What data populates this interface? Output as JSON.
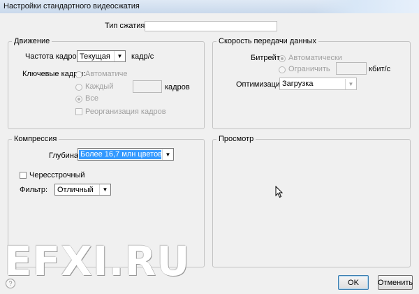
{
  "window": {
    "title": "Настройки стандартного видеосжатия"
  },
  "compression_type": {
    "label": "Тип сжатия:",
    "value": ""
  },
  "motion": {
    "legend": "Движение",
    "frame_rate": {
      "label": "Частота кадров:",
      "value": "Текущая",
      "unit": "кадр/с"
    },
    "key_frames": {
      "label": "Ключевые кадры:",
      "auto": "Автоматически",
      "every": "Каждый",
      "every_value": "",
      "every_unit": "кадров",
      "all": "Все",
      "reorder": "Реорганизация кадров"
    }
  },
  "data_rate": {
    "legend": "Скорость передачи данных",
    "bitrate_label": "Битрейт:",
    "auto": "Автоматически",
    "limit": "Ограничить",
    "limit_value": "",
    "limit_unit": "кбит/с",
    "optimization_label": "Оптимизация:",
    "optimization_value": "Загрузка"
  },
  "compression": {
    "legend": "Компрессия",
    "depth_label": "Глубина:",
    "depth_value": "Более 16,7 млн цветов",
    "interlaced": "Чересстрочный",
    "filter_label": "Фильтр:",
    "filter_value": "Отличный"
  },
  "preview": {
    "legend": "Просмотр"
  },
  "buttons": {
    "ok": "OK",
    "cancel": "Отменить",
    "help": "?"
  },
  "watermark": "EFXI.RU"
}
